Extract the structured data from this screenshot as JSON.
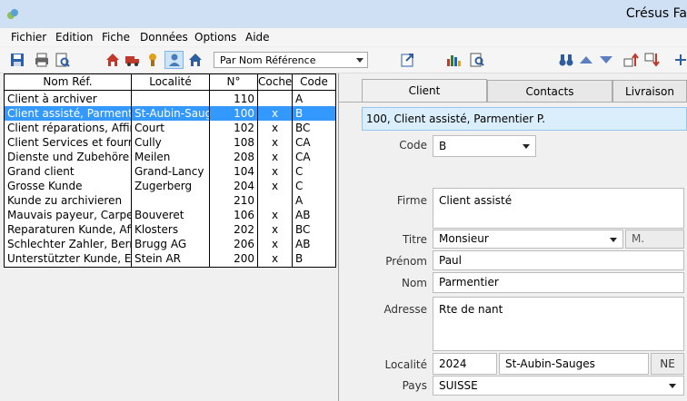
{
  "window": {
    "title": "Crésus Fa"
  },
  "menu": {
    "items": [
      "Fichier",
      "Edition",
      "Fiche",
      "Données",
      "Options",
      "Aide"
    ]
  },
  "toolbar": {
    "sort_selected": "Par Nom Référence"
  },
  "list": {
    "headers": [
      "Nom Réf.",
      "Localité",
      "N°",
      "Coche",
      "Code"
    ],
    "rows": [
      {
        "nom": "Client à archiver",
        "localite": "",
        "no": "110",
        "coche": "",
        "code": "A"
      },
      {
        "nom": "Client assisté, Parmentier P.",
        "localite": "St-Aubin-Sauges",
        "no": "100",
        "coche": "x",
        "code": "B"
      },
      {
        "nom": "Client réparations, Affine",
        "localite": "Court",
        "no": "102",
        "coche": "x",
        "code": "BC"
      },
      {
        "nom": "Client Services et fournitures",
        "localite": "Cully",
        "no": "108",
        "coche": "x",
        "code": "CA"
      },
      {
        "nom": "Dienste und Zubehöre Kunde",
        "localite": "Meilen",
        "no": "208",
        "coche": "x",
        "code": "CA"
      },
      {
        "nom": "Grand client",
        "localite": "Grand-Lancy",
        "no": "104",
        "coche": "x",
        "code": "C"
      },
      {
        "nom": "Grosse Kunde",
        "localite": "Zugerberg",
        "no": "204",
        "coche": "x",
        "code": "C"
      },
      {
        "nom": "Kunde zu archivieren",
        "localite": "",
        "no": "210",
        "coche": "",
        "code": "A"
      },
      {
        "nom": "Mauvais payeur, Carpe A.",
        "localite": "Bouveret",
        "no": "106",
        "coche": "x",
        "code": "AB"
      },
      {
        "nom": "Reparaturen Kunde, Affine",
        "localite": "Klosters",
        "no": "202",
        "coche": "x",
        "code": "BC"
      },
      {
        "nom": "Schlechter Zahler, Bernhard",
        "localite": "Brugg AG",
        "no": "206",
        "coche": "x",
        "code": "AB"
      },
      {
        "nom": "Unterstützter Kunde, Ella G.",
        "localite": "Stein AR",
        "no": "200",
        "coche": "x",
        "code": "B"
      }
    ],
    "selected_index": 1
  },
  "tabs": [
    "Client",
    "Contacts",
    "Livraison"
  ],
  "active_tab": "Client",
  "detail": {
    "header": "100, Client assisté, Parmentier P.",
    "code_label": "Code",
    "code_value": "B",
    "firme_label": "Firme",
    "firme_value": "Client assisté",
    "titre_label": "Titre",
    "titre_value": "Monsieur",
    "titre_short": "M.",
    "prenom_label": "Prénom",
    "prenom_value": "Paul",
    "nom_label": "Nom",
    "nom_value": "Parmentier",
    "adresse_label": "Adresse",
    "adresse_value": "Rte de nant",
    "localite_label": "Localité",
    "npa_value": "2024",
    "localite_value": "St-Aubin-Sauges",
    "canton_value": "NE",
    "pays_label": "Pays",
    "pays_value": "SUISSE"
  },
  "colors": {
    "selection": "#3399ff",
    "titlebar": "#cfe0f4",
    "infobar": "#dbeefc"
  }
}
